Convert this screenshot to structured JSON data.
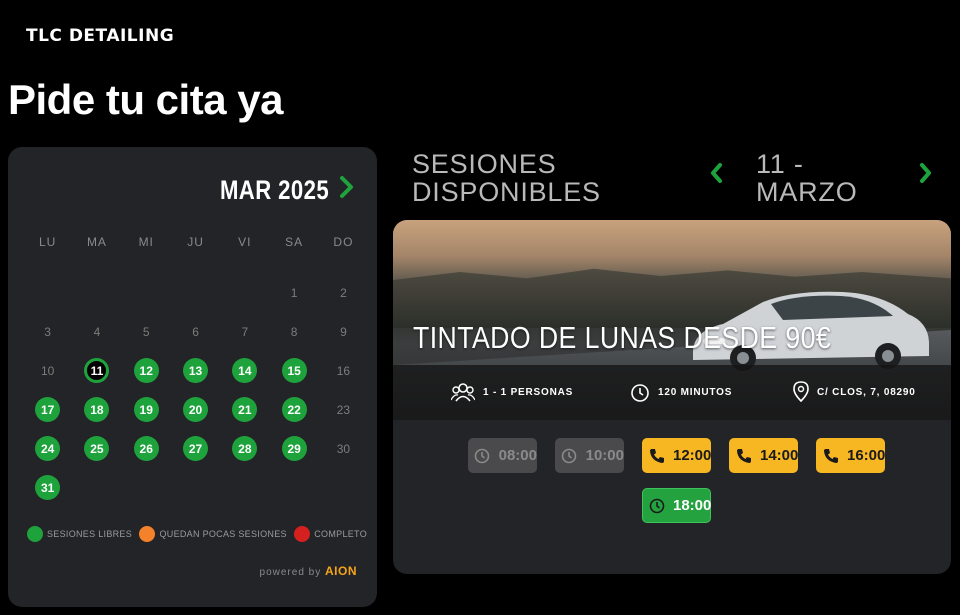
{
  "brand": {
    "logo_text": "TLC DETAILING"
  },
  "page": {
    "title": "Pide tu cita ya"
  },
  "calendar": {
    "month_label": "MAR 2025",
    "next_icon": "chevron-right-icon",
    "weekdays": [
      "LU",
      "MA",
      "MI",
      "JU",
      "VI",
      "SA",
      "DO"
    ],
    "days": [
      {
        "n": "",
        "state": "empty"
      },
      {
        "n": "",
        "state": "empty"
      },
      {
        "n": "",
        "state": "empty"
      },
      {
        "n": "",
        "state": "empty"
      },
      {
        "n": "",
        "state": "empty"
      },
      {
        "n": "1",
        "state": "off"
      },
      {
        "n": "2",
        "state": "off"
      },
      {
        "n": "3",
        "state": "off"
      },
      {
        "n": "4",
        "state": "off"
      },
      {
        "n": "5",
        "state": "off"
      },
      {
        "n": "6",
        "state": "off"
      },
      {
        "n": "7",
        "state": "off"
      },
      {
        "n": "8",
        "state": "off"
      },
      {
        "n": "9",
        "state": "off"
      },
      {
        "n": "10",
        "state": "off"
      },
      {
        "n": "11",
        "state": "selected"
      },
      {
        "n": "12",
        "state": "avail"
      },
      {
        "n": "13",
        "state": "avail"
      },
      {
        "n": "14",
        "state": "avail"
      },
      {
        "n": "15",
        "state": "avail"
      },
      {
        "n": "16",
        "state": "off"
      },
      {
        "n": "17",
        "state": "avail"
      },
      {
        "n": "18",
        "state": "avail"
      },
      {
        "n": "19",
        "state": "avail"
      },
      {
        "n": "20",
        "state": "avail"
      },
      {
        "n": "21",
        "state": "avail"
      },
      {
        "n": "22",
        "state": "avail"
      },
      {
        "n": "23",
        "state": "off"
      },
      {
        "n": "24",
        "state": "avail"
      },
      {
        "n": "25",
        "state": "avail"
      },
      {
        "n": "26",
        "state": "avail"
      },
      {
        "n": "27",
        "state": "avail"
      },
      {
        "n": "28",
        "state": "avail"
      },
      {
        "n": "29",
        "state": "avail"
      },
      {
        "n": "30",
        "state": "off"
      },
      {
        "n": "31",
        "state": "avail"
      }
    ],
    "legend": [
      {
        "label": "SESIONES LIBRES",
        "color": "#1ea33c"
      },
      {
        "label": "QUEDAN POCAS SESIONES",
        "color": "#f3822b"
      },
      {
        "label": "COMPLETO",
        "color": "#d4201f"
      }
    ],
    "powered_by": "powered by",
    "powered_brand": "AION"
  },
  "sessions": {
    "title": "SESIONES DISPONIBLES",
    "date_label": "11 - MARZO",
    "prev_icon": "chevron-left-icon",
    "next_icon": "chevron-right-icon"
  },
  "service": {
    "title": "TINTADO DE LUNAS DESDE 90€",
    "people": "1 - 1 PERSONAS",
    "duration": "120 MINUTOS",
    "address": "C/ CLOS, 7, 08290",
    "slots": [
      {
        "time": "08:00",
        "state": "disabled",
        "icon": "clock-icon"
      },
      {
        "time": "10:00",
        "state": "disabled",
        "icon": "clock-icon"
      },
      {
        "time": "12:00",
        "state": "few",
        "icon": "phone-icon"
      },
      {
        "time": "14:00",
        "state": "few",
        "icon": "phone-icon"
      },
      {
        "time": "16:00",
        "state": "few",
        "icon": "phone-icon"
      },
      {
        "time": "18:00",
        "state": "free",
        "icon": "clock-icon"
      }
    ],
    "colors": {
      "free": "#23a23f",
      "few": "#f7b723",
      "disabled": "#4a4a4c"
    }
  }
}
